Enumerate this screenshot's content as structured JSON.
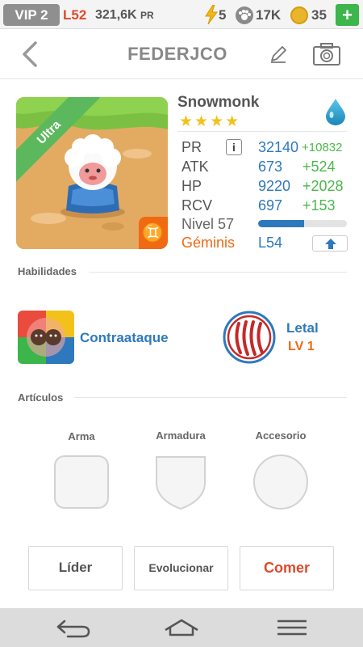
{
  "status": {
    "vip": "VIP 2",
    "level": "L52",
    "pr_amount": "321,6K",
    "pr_unit": "PR",
    "energy": "5",
    "paw": "17K",
    "coins": "35",
    "plus": "+"
  },
  "header": {
    "title": "FEDERJCO",
    "icons": [
      "back-arrow-icon",
      "pencil-icon",
      "camera-icon"
    ]
  },
  "monster": {
    "ribbon": "Ultra",
    "name": "Snowmonk",
    "stars": "★★★★",
    "star_count": 4,
    "element_icon": "water-drop-icon",
    "stats": {
      "pr_label": "PR",
      "pr_value": "32140",
      "pr_bonus": "+10832",
      "atk_label": "ATK",
      "atk_value": "673",
      "atk_bonus": "+524",
      "hp_label": "HP",
      "hp_value": "9220",
      "hp_bonus": "+2028",
      "rcv_label": "RCV",
      "rcv_value": "697",
      "rcv_bonus": "+153",
      "level_label": "Nivel 57",
      "xp_fraction": 0.52,
      "sign_label": "Géminis",
      "sign_symbol": "♊",
      "sign_level": "L54",
      "info_glyph": "i"
    }
  },
  "sections": {
    "abilities": "Habilidades",
    "items": "Artículos"
  },
  "abilities": {
    "skill": "Contraataque",
    "passive_name": "Letal",
    "passive_level": "LV 1"
  },
  "items": {
    "weapon": "Arma",
    "armor": "Armadura",
    "accessory": "Accesorio"
  },
  "actions": {
    "leader": "Líder",
    "evolve": "Evolucionar",
    "eat": "Comer"
  },
  "colors": {
    "accent_blue": "#2e79bd",
    "accent_orange": "#ef6a12",
    "bonus_green": "#4cb84c",
    "level_red": "#e0492b"
  }
}
